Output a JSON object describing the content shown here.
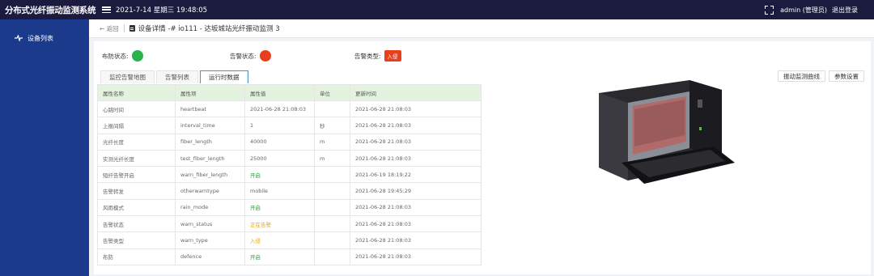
{
  "app": {
    "title": "分布式光纤振动监测系统",
    "datetime": "2021-7-14 星期三 19:48:05",
    "user": "admin (管理员)",
    "logout": "退出登录"
  },
  "sidebar": {
    "items": [
      {
        "label": "设备列表",
        "icon": "pulse-icon"
      }
    ]
  },
  "breadcrumb": {
    "back": "返回",
    "title": "设备详情 -# io111 - 达坂城站光纤振动监测 3"
  },
  "status": {
    "defense_label": "布防状态:",
    "defense_color": "#2bb24c",
    "alarm_label": "告警状态:",
    "alarm_color": "#e8401c",
    "alarm_type_label": "告警类型:",
    "alarm_type_value": "入侵",
    "alarm_type_color": "#e8401c"
  },
  "tabs": [
    "监控告警地图",
    "告警列表",
    "运行时数据"
  ],
  "active_tab": 2,
  "actions": [
    "振动监测曲线",
    "参数设置"
  ],
  "table": {
    "headers": [
      "属性名称",
      "属性项",
      "属性值",
      "单位",
      "更新时间"
    ],
    "rows": [
      [
        "心跳时间",
        "heartbeat",
        "2021-06-28 21:08:03",
        "",
        "2021-06-28 21:08:03"
      ],
      [
        "上报间隔",
        "interval_time",
        "1",
        "秒",
        "2021-06-28 21:08:03"
      ],
      [
        "光纤长度",
        "fiber_length",
        "40000",
        "m",
        "2021-06-28 21:08:03"
      ],
      [
        "实测光纤长度",
        "test_fiber_length",
        "25000",
        "m",
        "2021-06-28 21:08:03"
      ],
      [
        "短纤告警开启",
        "warn_fiber_length",
        "开启",
        "",
        "2021-06-19 18:19:22"
      ],
      [
        "告警转发",
        "otherwarntype",
        "mobile",
        "",
        "2021-06-28 19:45:29"
      ],
      [
        "风雨模式",
        "rain_mode",
        "开启",
        "",
        "2021-06-28 21:08:03"
      ],
      [
        "告警状态",
        "warn_status",
        "正在告警",
        "",
        "2021-06-28 21:08:03"
      ],
      [
        "告警类型",
        "warn_type",
        "入侵",
        "",
        "2021-06-28 21:08:03"
      ],
      [
        "布防",
        "defence",
        "开启",
        "",
        "2021-06-28 21:08:03"
      ]
    ],
    "value_colors": [
      "",
      "",
      "",
      "",
      "#2e9e3c",
      "",
      "#2e9e3c",
      "#e8a317",
      "#e8a317",
      "#2e9e3c"
    ]
  }
}
